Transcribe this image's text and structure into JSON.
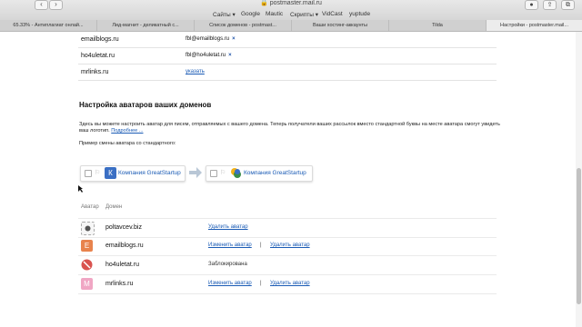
{
  "browser": {
    "url": "postmaster.mail.ru",
    "bookmarks": [
      "Сайты ▾",
      "Google",
      "Mautic",
      "Скрипты ▾",
      "VidCast",
      "yuptude"
    ],
    "tabs": [
      {
        "label": "65.33% - Антиплагиат онлай..."
      },
      {
        "label": "Лид-магнит - деликатный с..."
      },
      {
        "label": "Список доменов - postmast..."
      },
      {
        "label": "Ваши хостинг-аккаунты"
      },
      {
        "label": "Tilda"
      },
      {
        "label": "Настройки - postmaster.mail..."
      }
    ]
  },
  "domain_rows": [
    {
      "domain": "emailblogs.ru",
      "email": "fbl@emailblogs.ru",
      "remove": "×"
    },
    {
      "domain": "ho4uletat.ru",
      "email": "fbl@ho4uletat.ru",
      "remove": "×"
    },
    {
      "domain": "mrlinks.ru",
      "email": "указать"
    }
  ],
  "avatar_section": {
    "title": "Настройка аватаров ваших доменов",
    "description": "Здесь вы можете настроить аватар для писем, отправляемых с вашего домена. Теперь получатели ваших рассылок вместо стандартной буквы на месте аватара смогут увидеть ваш логотип.",
    "more_link": "Подробнее ...",
    "example_text": "Пример смены аватара со стандартного:",
    "demo_before_letter": "К",
    "demo_label": "Компания GreatStartup",
    "col_avatar": "Аватар",
    "col_domain": "Домен",
    "rows": [
      {
        "domain": "poltavcev.biz",
        "action1": "Удалить аватар"
      },
      {
        "domain": "emailblogs.ru",
        "letter": "E",
        "action1": "Изменить аватар",
        "sep": "|",
        "action2": "Удалить аватар"
      },
      {
        "domain": "ho4uletat.ru",
        "status": "Заблокирована"
      },
      {
        "domain": "mrlinks.ru",
        "letter": "M",
        "action1": "Изменить аватар",
        "sep": "|",
        "action2": "Удалить аватар"
      }
    ]
  },
  "colors": {
    "link": "#1a5bb5",
    "avatar_e": "#e8834d",
    "avatar_m": "#f0a6c4",
    "avatar_blocked": "#d9534f",
    "demo_k": "#3a6fc4"
  }
}
